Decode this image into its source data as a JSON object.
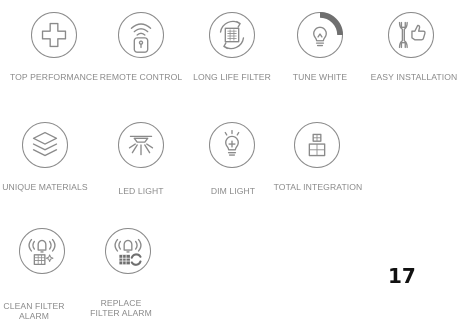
{
  "features": [
    {
      "id": "top-performance",
      "icon": "plus-icon",
      "label": "TOP PERFORMANCE"
    },
    {
      "id": "remote-control",
      "icon": "remote-control-icon",
      "label": "REMOTE CONTROL"
    },
    {
      "id": "long-life-filter",
      "icon": "filter-cycle-icon",
      "label": "LONG LIFE FILTER"
    },
    {
      "id": "tune-white",
      "icon": "bulb-tune-icon",
      "label": "TUNE WHITE"
    },
    {
      "id": "easy-installation",
      "icon": "wrench-thumbs-up-icon",
      "label": "EASY INSTALLATION"
    },
    {
      "id": "unique-materials",
      "icon": "layers-icon",
      "label": "UNIQUE MATERIALS"
    },
    {
      "id": "led-light",
      "icon": "ceiling-lamp-icon",
      "label": "LED LIGHT"
    },
    {
      "id": "dim-light",
      "icon": "dimmable-bulb-icon",
      "label": "DIM LIGHT"
    },
    {
      "id": "total-integration",
      "icon": "grid-integration-icon",
      "label": "TOTAL INTEGRATION"
    },
    {
      "id": "clean-filter-alarm",
      "icon": "alarm-clean-filter-icon",
      "label": "CLEAN FILTER ALARM"
    },
    {
      "id": "replace-filter-alarm",
      "icon": "alarm-replace-filter-icon",
      "label": "REPLACE FILTER ALARM"
    }
  ],
  "page_number": "17",
  "colors": {
    "icon_gray": "#8a8a8a",
    "text_gray": "#8a8a8a",
    "page_number": "#111111"
  }
}
